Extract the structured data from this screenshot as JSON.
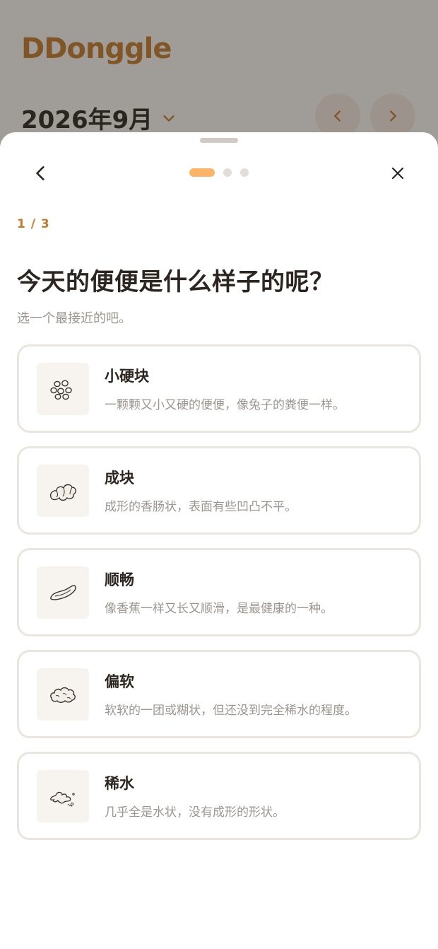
{
  "app": {
    "logo": "DDonggle",
    "month": "2026年9月"
  },
  "sheet": {
    "step": "1 / 3",
    "title": "今天的便便是什么样子的呢？",
    "subtitle": "选一个最接近的吧。",
    "options": [
      {
        "title": "小硬块",
        "desc": "一颗颗又小又硬的便便，像兔子的粪便一样。",
        "icon": "pellets-icon"
      },
      {
        "title": "成块",
        "desc": "成形的香肠状，表面有些凹凸不平。",
        "icon": "lumpy-sausage-icon"
      },
      {
        "title": "顺畅",
        "desc": "像香蕉一样又长又顺滑，是最健康的一种。",
        "icon": "smooth-banana-icon"
      },
      {
        "title": "偏软",
        "desc": "软软的一团或糊状，但还没到完全稀水的程度。",
        "icon": "soft-blob-icon"
      },
      {
        "title": "稀水",
        "desc": "几乎全是水状，没有成形的形状。",
        "icon": "watery-splash-icon"
      }
    ]
  },
  "colors": {
    "accent": "#fbb468",
    "brand": "#c27a2c",
    "text": "#2d2620",
    "muted": "#9c958f",
    "border": "#ebe6dd"
  }
}
